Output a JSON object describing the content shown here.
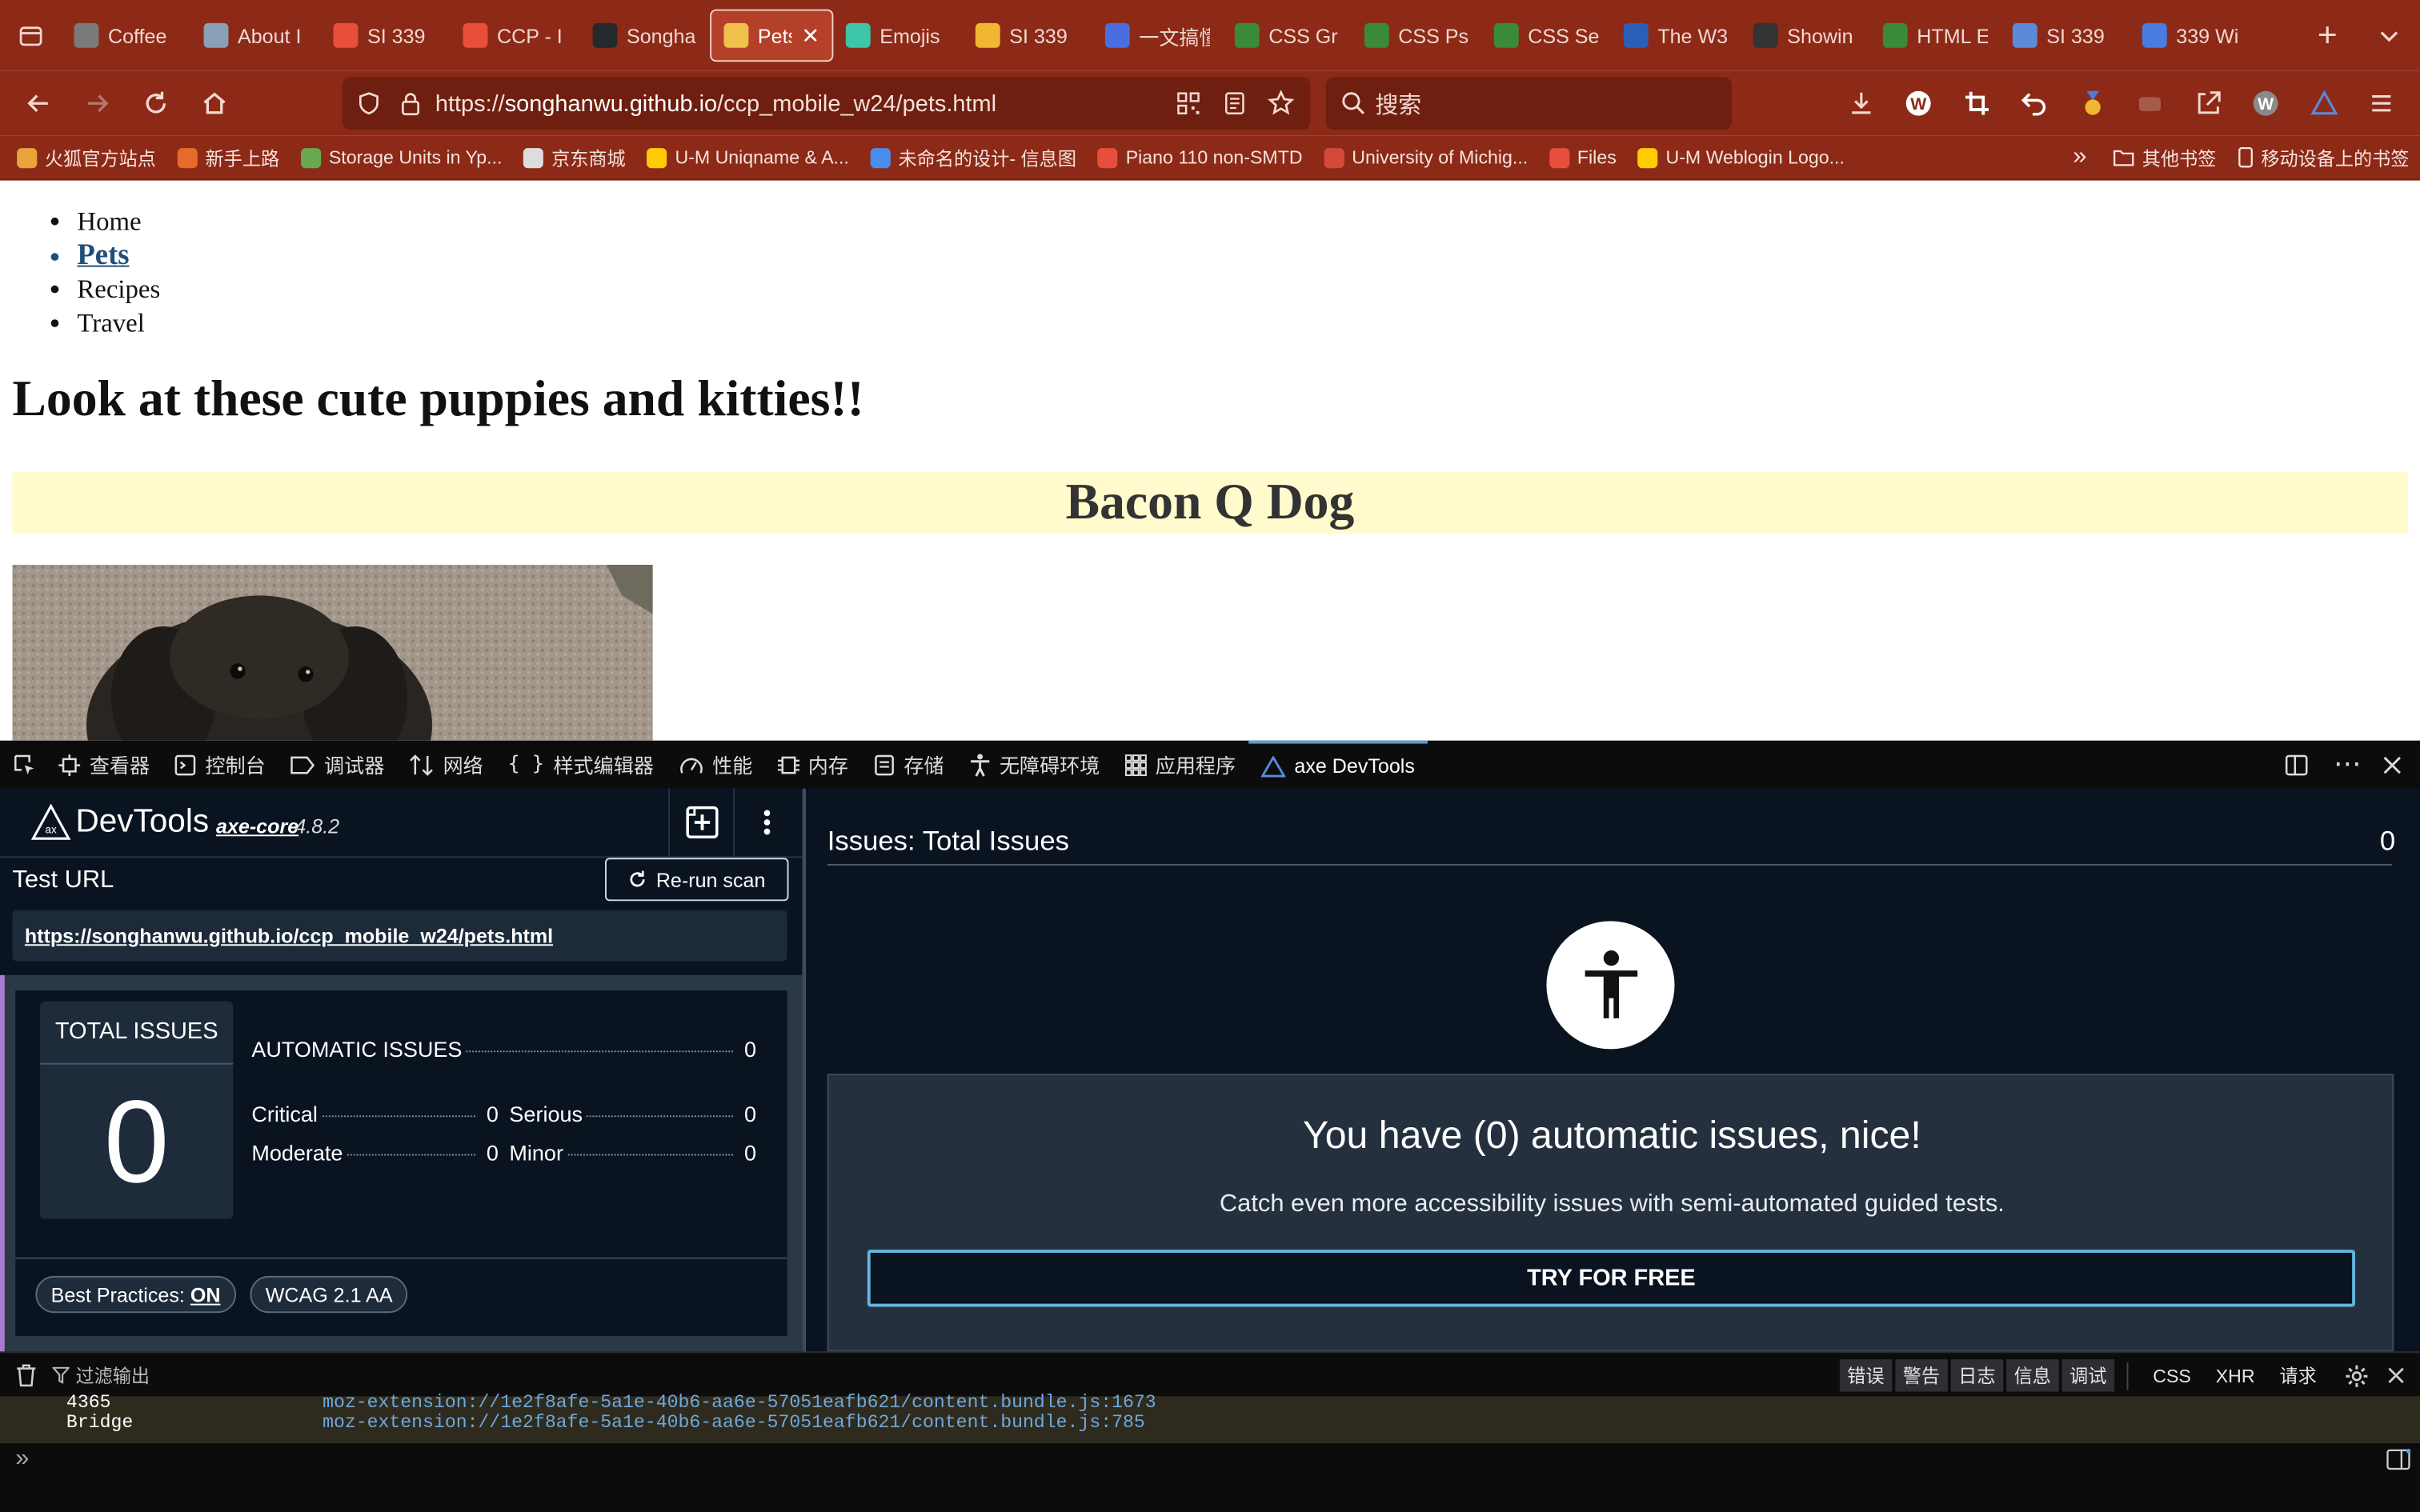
{
  "browser": {
    "tabs": [
      {
        "title": "Coffee",
        "favicon_color": "#7a7a7a"
      },
      {
        "title": "About I",
        "favicon_color": "#8aa0b8"
      },
      {
        "title": "SI 339",
        "favicon_color": "#e84e3c"
      },
      {
        "title": "CCP - I",
        "favicon_color": "#e84e3c"
      },
      {
        "title": "Songha",
        "favicon_color": "#24292e"
      },
      {
        "title": "Pets",
        "favicon_color": "#f0c04a",
        "active": true
      },
      {
        "title": "Emojis",
        "favicon_color": "#3ec6a8"
      },
      {
        "title": "SI 339",
        "favicon_color": "#f2b632"
      },
      {
        "title": "一文搞懂",
        "favicon_color": "#4a6ee0"
      },
      {
        "title": "CSS Gr",
        "favicon_color": "#3a8a3a"
      },
      {
        "title": "CSS Ps",
        "favicon_color": "#3a8a3a"
      },
      {
        "title": "CSS Se",
        "favicon_color": "#3a8a3a"
      },
      {
        "title": "The W3",
        "favicon_color": "#2a5fb8"
      },
      {
        "title": "Showin",
        "favicon_color": "#333333"
      },
      {
        "title": "HTML E",
        "favicon_color": "#3a8a3a"
      },
      {
        "title": "SI 339",
        "favicon_color": "#5b8bd8"
      },
      {
        "title": "339 Wi",
        "favicon_color": "#4a7be0"
      }
    ],
    "url": {
      "scheme": "https://",
      "host": "songhanwu.github.io",
      "path": "/ccp_mobile_w24/pets.html"
    },
    "search_placeholder": "搜索",
    "bookmarks": [
      {
        "label": "火狐官方站点",
        "color": "#e8a33a"
      },
      {
        "label": "新手上路",
        "color": "#e86a2a"
      },
      {
        "label": "Storage Units in Yp...",
        "color": "#6aa84f"
      },
      {
        "label": "京东商城",
        "color": "#dddddd"
      },
      {
        "label": "U-M Uniqname & A...",
        "color": "#ffcb05"
      },
      {
        "label": "未命名的设计- 信息图",
        "color": "#4a8cf0"
      },
      {
        "label": "Piano 110 non-SMTD",
        "color": "#e84e3c"
      },
      {
        "label": "University of Michig...",
        "color": "#d44a3a"
      },
      {
        "label": "Files",
        "color": "#e84e3c"
      },
      {
        "label": "U-M Weblogin Logo...",
        "color": "#ffcb05"
      }
    ],
    "bookmarks_right": [
      "其他书签",
      "移动设备上的书签"
    ]
  },
  "page": {
    "nav": [
      "Home",
      "Pets",
      "Recipes",
      "Travel"
    ],
    "current_nav": "Pets",
    "heading": "Look at these cute puppies and kitties!!",
    "banner": "Bacon Q Dog",
    "banner_color": "#fffbcc"
  },
  "devtools": {
    "tools": [
      "查看器",
      "控制台",
      "调试器",
      "网络",
      "样式编辑器",
      "性能",
      "内存",
      "存储",
      "无障碍环境",
      "应用程序",
      "axe DevTools"
    ],
    "active_tool": "axe DevTools"
  },
  "axe": {
    "title": "DevTools",
    "core_label": "axe-core",
    "version": "4.8.2",
    "test_url_label": "Test URL",
    "rerun_label": "Re-run scan",
    "test_url": "https://songhanwu.github.io/ccp_mobile_w24/pets.html",
    "total_label": "TOTAL ISSUES",
    "total": "0",
    "automatic_label": "AUTOMATIC ISSUES",
    "automatic": "0",
    "critical_label": "Critical",
    "critical": "0",
    "serious_label": "Serious",
    "serious": "0",
    "moderate_label": "Moderate",
    "moderate": "0",
    "minor_label": "Minor",
    "minor": "0",
    "best_practices_label": "Best Practices:",
    "best_practices_value": "ON",
    "wcag_label": "WCAG 2.1 AA",
    "issues_title": "Issues: Total Issues",
    "issues_count": "0",
    "result_main": "You have (0) automatic issues, nice!",
    "result_sub": "Catch even more accessibility issues with semi-automated guided tests.",
    "cta": "TRY FOR FREE",
    "accent_color": "#63b7df"
  },
  "console": {
    "filter_label": "过滤输出",
    "levels": [
      "错误",
      "警告",
      "日志",
      "信息",
      "调试"
    ],
    "types": [
      "CSS",
      "XHR",
      "请求"
    ],
    "logs": [
      {
        "text": "4365",
        "source": "moz-extension://1e2f8afe-5a1e-40b6-aa6e-57051eafb621/content.bundle.js:1673"
      },
      {
        "text": "Bridge",
        "source": "moz-extension://1e2f8afe-5a1e-40b6-aa6e-57051eafb621/content.bundle.js:785"
      }
    ],
    "prompt_symbol": "»"
  }
}
